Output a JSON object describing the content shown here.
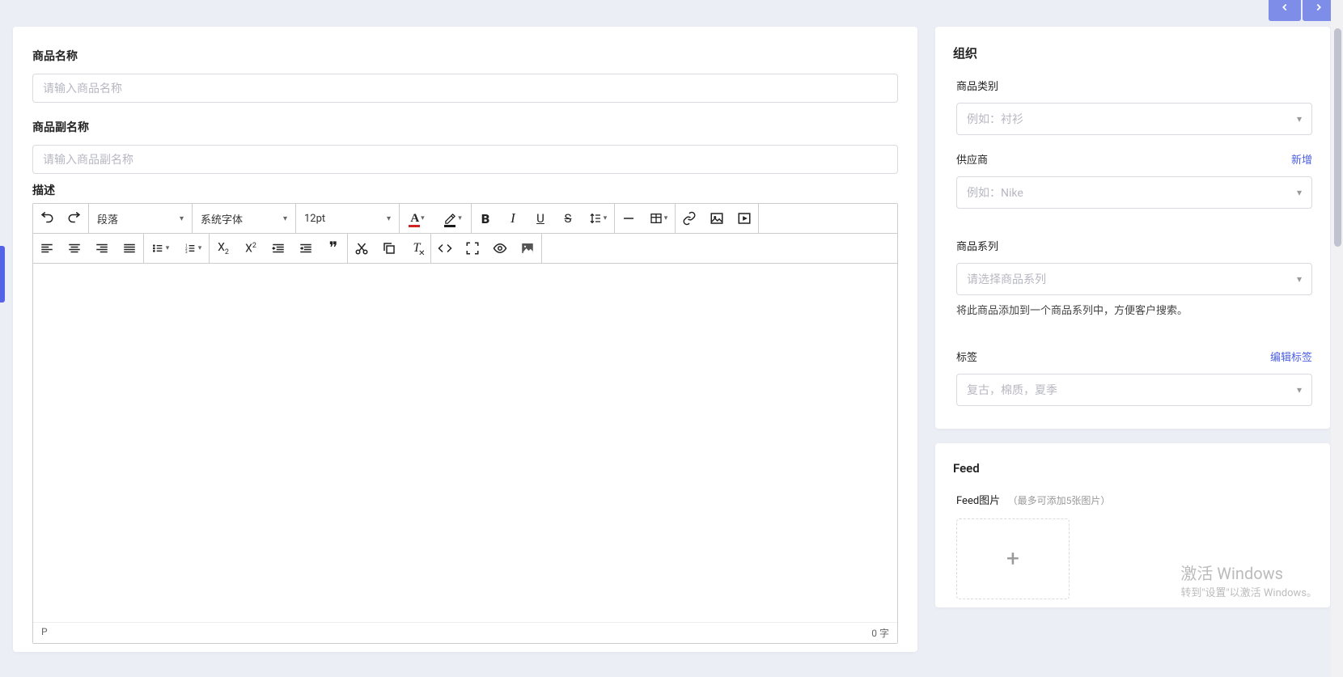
{
  "main": {
    "product_name_label": "商品名称",
    "product_name_placeholder": "请输入商品名称",
    "product_subname_label": "商品副名称",
    "product_subname_placeholder": "请输入商品副名称",
    "description_label": "描述"
  },
  "editor": {
    "block_format": "段落",
    "font_family": "系统字体",
    "font_size": "12pt",
    "status_path": "P",
    "status_words": "0 字"
  },
  "organization": {
    "title": "组织",
    "category_label": "商品类别",
    "category_placeholder": "例如：衬衫",
    "supplier_label": "供应商",
    "supplier_add_link": "新增",
    "supplier_placeholder": "例如：Nike",
    "series_label": "商品系列",
    "series_placeholder": "请选择商品系列",
    "series_helper": "将此商品添加到一个商品系列中，方便客户搜索。",
    "tags_label": "标签",
    "tags_edit_link": "编辑标签",
    "tags_placeholder": "复古，棉质，夏季"
  },
  "feed": {
    "title": "Feed",
    "image_label": "Feed图片",
    "image_note": "（最多可添加5张图片）",
    "upload_symbol": "+"
  },
  "watermark": {
    "line1": "激活 Windows",
    "line2": "转到\"设置\"以激活 Windows。"
  }
}
